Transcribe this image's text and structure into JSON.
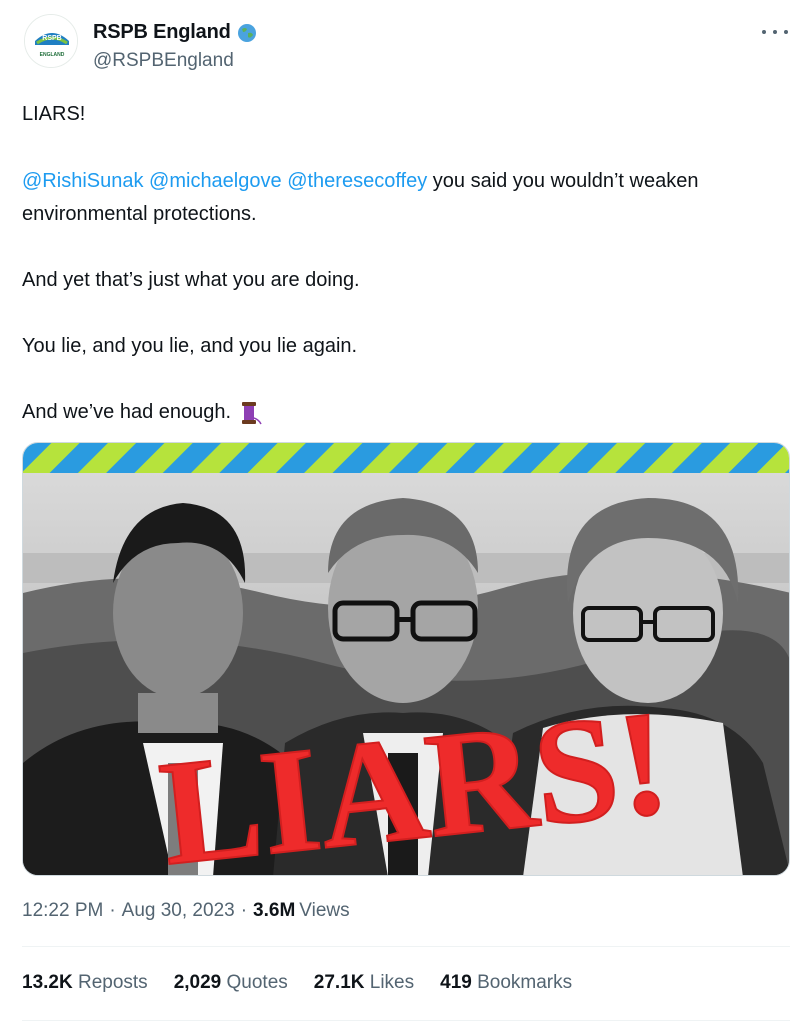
{
  "author": {
    "display_name": "RSPB England",
    "handle": "@RSPBEngland",
    "avatar_text_top": "RSPB",
    "avatar_text_bottom": "ENGLAND",
    "badge_icon": "globe-icon"
  },
  "tweet": {
    "line1": "LIARS!",
    "mentions": [
      "@RishiSunak",
      "@michaelgove",
      "@theresecoffey"
    ],
    "line2_rest": " you said you wouldn’t weaken environmental protections.",
    "line3": "And yet that’s just what you are doing.",
    "line4": "You lie, and you lie, and you lie again.",
    "line5": "And we’ve had enough.",
    "emoji_icon": "thread-spool-icon"
  },
  "media": {
    "overlay_text": "LIARS!",
    "stripe_colors": [
      "#2a9be0",
      "#b6e33c"
    ],
    "overlay_color": "#ee2b2b"
  },
  "meta": {
    "time": "12:22 PM",
    "date": "Aug 30, 2023",
    "views_count": "3.6M",
    "views_label": "Views"
  },
  "stats": {
    "reposts_count": "13.2K",
    "reposts_label": "Reposts",
    "quotes_count": "2,029",
    "quotes_label": "Quotes",
    "likes_count": "27.1K",
    "likes_label": "Likes",
    "bookmarks_count": "419",
    "bookmarks_label": "Bookmarks"
  },
  "colors": {
    "link": "#1d9bf0",
    "secondary_text": "#536471",
    "primary_text": "#0f1419"
  }
}
